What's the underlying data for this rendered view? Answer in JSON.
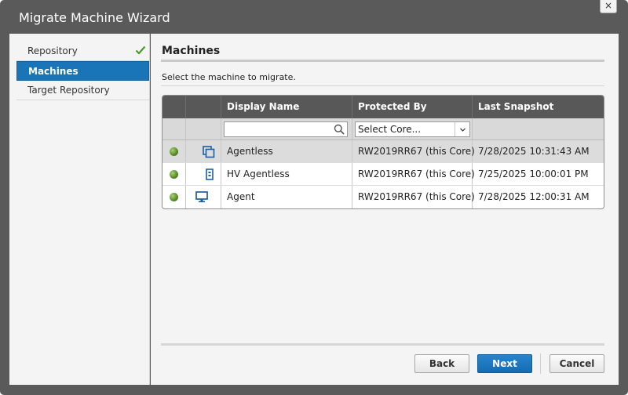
{
  "window": {
    "title": "Migrate Machine Wizard",
    "close_label": "×"
  },
  "sidebar": {
    "items": [
      {
        "label": "Repository",
        "completed": true
      },
      {
        "label": "Machines",
        "active": true
      },
      {
        "label": "Target Repository"
      }
    ]
  },
  "main": {
    "section_title": "Machines",
    "instructions": "Select the machine to migrate."
  },
  "grid": {
    "columns": [
      "",
      "",
      "Display Name",
      "Protected By",
      "Last Snapshot"
    ],
    "filters": {
      "name_placeholder": "",
      "core_selected": "Select Core..."
    },
    "rows": [
      {
        "status": "online",
        "icon": "agentless-vm-icon",
        "name": "Agentless",
        "protected_by": "RW2019RR67 (this Core)",
        "last_snapshot": "7/28/2025 10:31:43 AM",
        "selected": true
      },
      {
        "status": "online",
        "icon": "server-icon",
        "name": "HV Agentless",
        "protected_by": "RW2019RR67 (this Core)",
        "last_snapshot": "7/25/2025 10:00:01 PM"
      },
      {
        "status": "online",
        "icon": "monitor-icon",
        "name": "Agent",
        "protected_by": "RW2019RR67 (this Core)",
        "last_snapshot": "7/28/2025 12:00:31 AM"
      }
    ]
  },
  "buttons": {
    "back": "Back",
    "next": "Next",
    "cancel": "Cancel"
  },
  "colors": {
    "accent": "#1a74b8",
    "status_online": "#5c8f2c",
    "check": "#4a9a2a"
  }
}
